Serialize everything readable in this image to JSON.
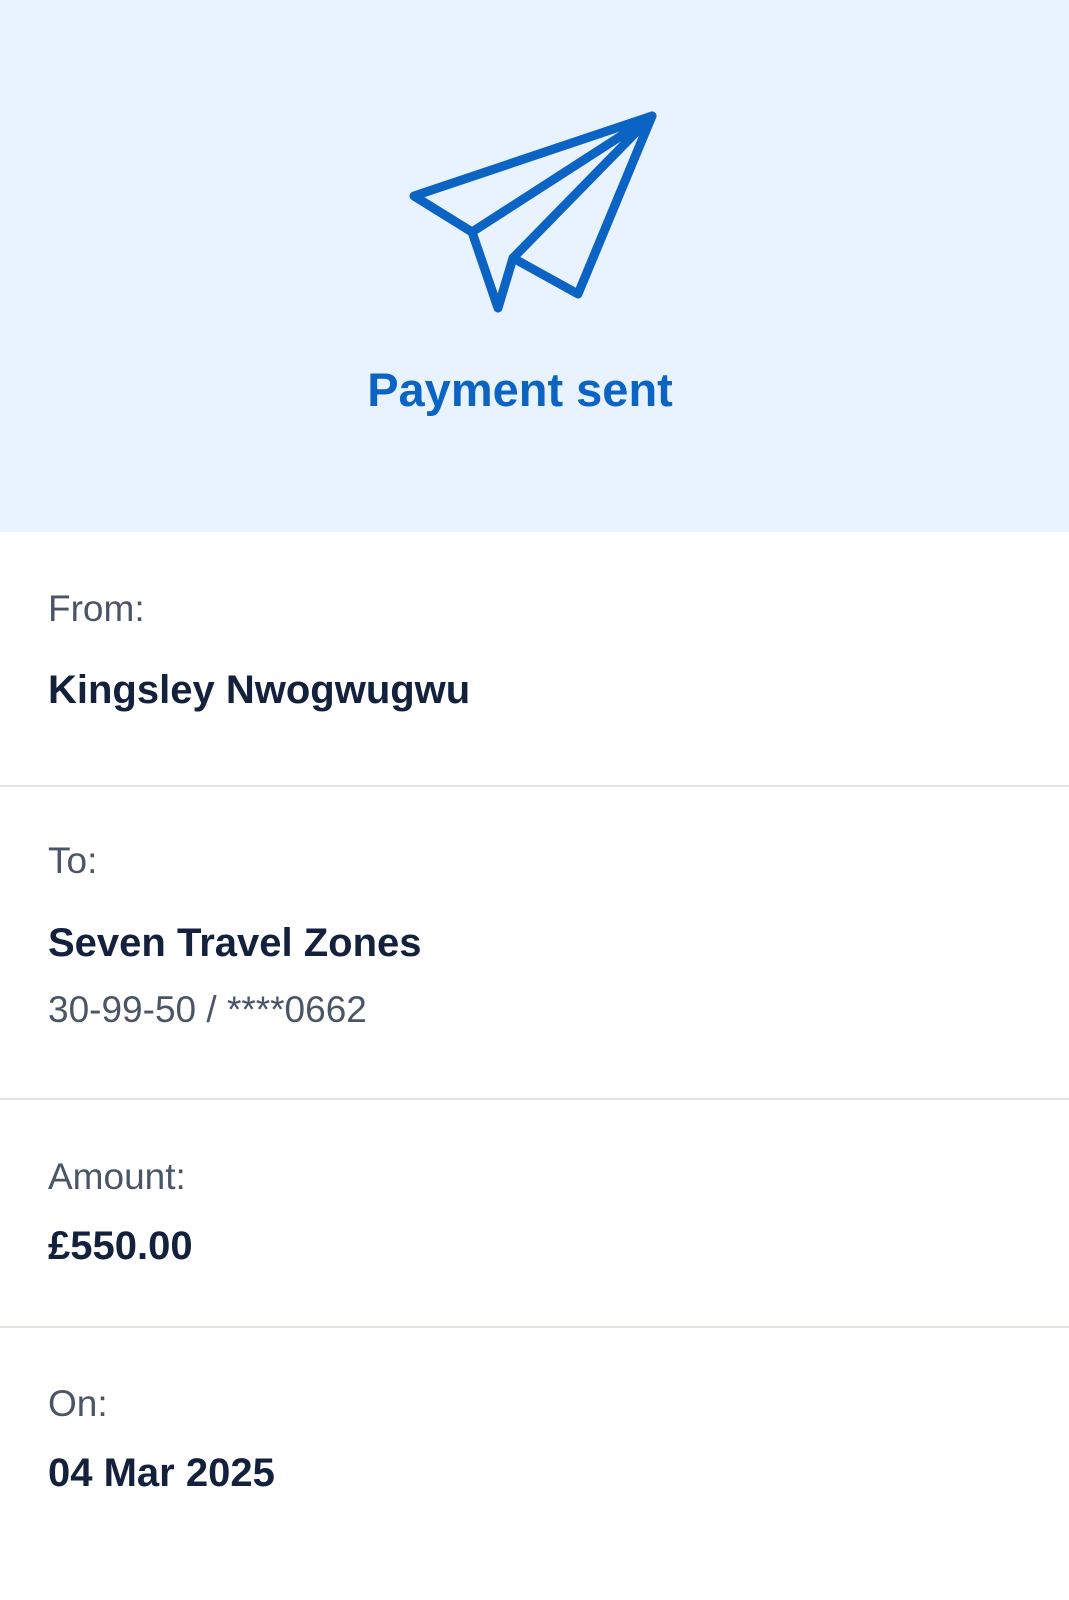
{
  "header": {
    "icon": "paper-plane-icon",
    "title": "Payment sent",
    "accent_color": "#0b63c4",
    "background_color": "#e9f3ff"
  },
  "details": {
    "from": {
      "label": "From:",
      "value": "Kingsley Nwogwugwu"
    },
    "to": {
      "label": "To:",
      "value": "Seven Travel Zones",
      "account": "30-99-50 / ****0662"
    },
    "amount": {
      "label": "Amount:",
      "value": "£550.00"
    },
    "on": {
      "label": "On:",
      "value": "04 Mar 2025"
    }
  }
}
